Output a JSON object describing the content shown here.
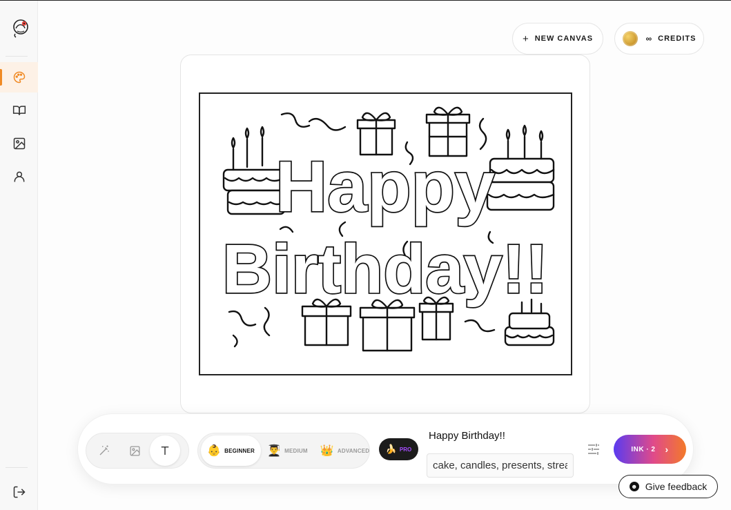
{
  "sidebar": {
    "items": [
      {
        "name": "palette-icon",
        "active": true
      },
      {
        "name": "book-icon",
        "active": false
      },
      {
        "name": "image-icon",
        "active": false
      },
      {
        "name": "user-icon",
        "active": false
      }
    ],
    "logout_icon": "logout-icon"
  },
  "header": {
    "new_canvas_label": "NEW CANVAS",
    "credits_value": "∞",
    "credits_label": "CREDITS"
  },
  "canvas": {
    "line1": "Happy",
    "line2": "Birthday!!"
  },
  "toolbar": {
    "modes": [
      "magic-wand-icon",
      "image-icon",
      "text-icon"
    ],
    "active_mode": "text",
    "levels": [
      {
        "label": "BEGINNER",
        "emoji": "👶"
      },
      {
        "label": "MEDIUM",
        "emoji": "👨‍🎓"
      },
      {
        "label": "ADVANCED",
        "emoji": "👑"
      }
    ],
    "active_level": "BEGINNER",
    "pro_label": "PRO",
    "title_value": "Happy Birthday!!",
    "keywords_value": "cake, candles, presents, streamers",
    "ink_label": "INK · 2"
  },
  "feedback_label": "Give feedback"
}
